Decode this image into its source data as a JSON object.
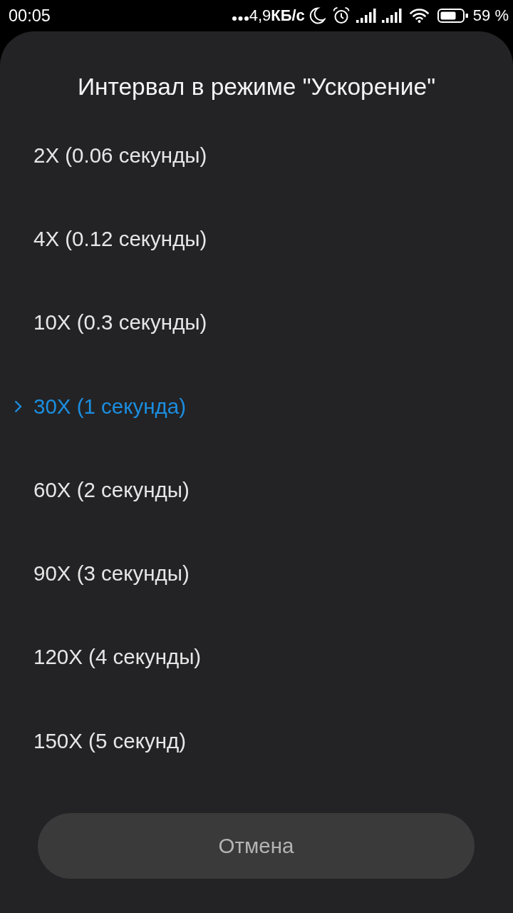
{
  "status_bar": {
    "time": "00:05",
    "network_speed": "4,9**КБ/с**",
    "battery_percent": "59 %"
  },
  "dialog": {
    "title": "Интервал в режиме \"Ускорение\"",
    "options": [
      {
        "label": "2X (0.06 секунды)",
        "selected": false
      },
      {
        "label": "4X (0.12 секунды)",
        "selected": false
      },
      {
        "label": "10X (0.3 секунды)",
        "selected": false
      },
      {
        "label": "30X (1 секунда)",
        "selected": true
      },
      {
        "label": "60X (2 секунды)",
        "selected": false
      },
      {
        "label": "90X (3 секунды)",
        "selected": false
      },
      {
        "label": "120X (4 секунды)",
        "selected": false
      },
      {
        "label": "150X (5 секунд)",
        "selected": false
      }
    ],
    "cancel_button": "Отмена"
  }
}
